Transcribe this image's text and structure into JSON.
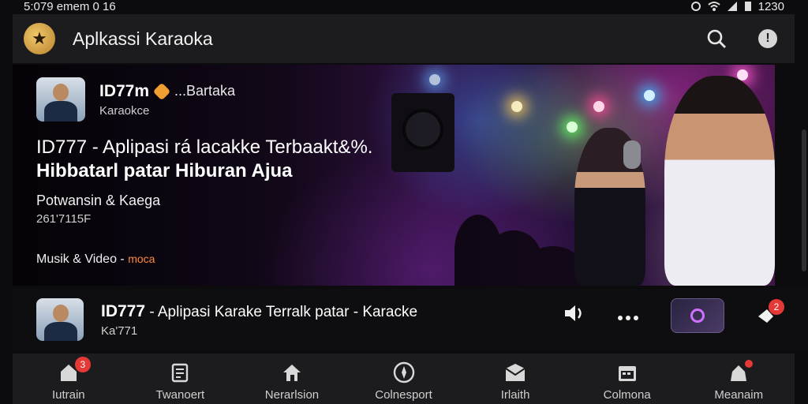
{
  "status": {
    "time": "5:079 emem 0 16",
    "clock": "1230"
  },
  "app": {
    "title": "Aplkassi Karaoka"
  },
  "appbar": {
    "search_icon": "search-icon",
    "info_icon": "info-icon",
    "info_glyph": "!"
  },
  "hero": {
    "channel_name": "ID77m",
    "channel_extra": "...Bartaka",
    "channel_sub": "Karaokce",
    "title_line1": "ID777 - Aplipasi rá lacakke Terbaakt&%.",
    "title_line2": "Hibbatarl patar Hiburan Ajua",
    "meta1": "Potwansin & Kaega",
    "meta2": "261'7115F",
    "tags": "Musik & Video -",
    "tags_accent": "moca"
  },
  "item": {
    "title_bold": "ID777",
    "title_rest": "- Aplipasi Karake Terralk patar - Karacke",
    "subtitle": "Ka'771",
    "notif_count": "2"
  },
  "nav": [
    {
      "label": "Iutrain",
      "icon": "home-icon",
      "badge": "3"
    },
    {
      "label": "Twanoert",
      "icon": "list-icon",
      "badge": ""
    },
    {
      "label": "Nerarlsion",
      "icon": "house-icon",
      "badge": ""
    },
    {
      "label": "Colnesport",
      "icon": "compass-icon",
      "badge": ""
    },
    {
      "label": "Irlaith",
      "icon": "inbox-icon",
      "badge": ""
    },
    {
      "label": "Colmona",
      "icon": "calendar-icon",
      "badge": ""
    },
    {
      "label": "Meanaim",
      "icon": "profile-icon",
      "badge": "•"
    }
  ]
}
